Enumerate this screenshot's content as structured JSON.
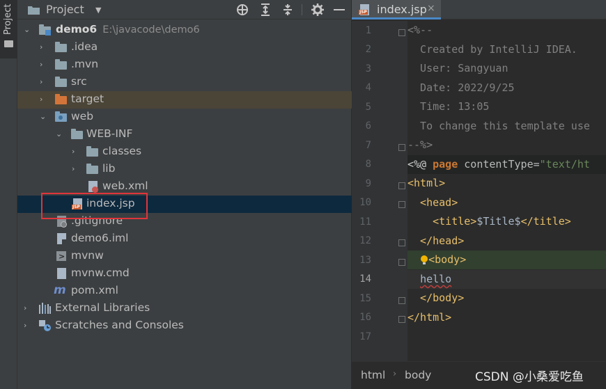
{
  "sidebar": {
    "vertical_tab": "Project"
  },
  "project_panel": {
    "title": "Project",
    "tree": [
      {
        "label": "demo6",
        "sub": "E:\\javacode\\demo6",
        "icon": "module-folder-icon",
        "expanded": true
      },
      {
        "label": ".idea",
        "icon": "folder-icon",
        "expanded": false
      },
      {
        "label": ".mvn",
        "icon": "folder-icon",
        "expanded": false
      },
      {
        "label": "src",
        "icon": "folder-icon",
        "expanded": false
      },
      {
        "label": "target",
        "icon": "excluded-folder-icon",
        "expanded": false
      },
      {
        "label": "web",
        "icon": "web-folder-icon",
        "expanded": true
      },
      {
        "label": "WEB-INF",
        "icon": "folder-icon",
        "expanded": true
      },
      {
        "label": "classes",
        "icon": "folder-icon",
        "expanded": false
      },
      {
        "label": "lib",
        "icon": "folder-icon",
        "expanded": false
      },
      {
        "label": "web.xml",
        "icon": "xml-file-icon"
      },
      {
        "label": "index.jsp",
        "icon": "jsp-file-icon"
      },
      {
        "label": ".gitignore",
        "icon": "gitignore-file-icon"
      },
      {
        "label": "demo6.iml",
        "icon": "iml-file-icon"
      },
      {
        "label": "mvnw",
        "icon": "script-file-icon"
      },
      {
        "label": "mvnw.cmd",
        "icon": "file-icon"
      },
      {
        "label": "pom.xml",
        "icon": "maven-icon"
      },
      {
        "label": "External Libraries",
        "icon": "libraries-icon",
        "expanded": false
      },
      {
        "label": "Scratches and Consoles",
        "icon": "scratches-icon",
        "expanded": false
      }
    ]
  },
  "editor": {
    "tab": {
      "label": "index.jsp",
      "close": "×"
    },
    "current_line": 14,
    "lines": [
      {
        "n": "1"
      },
      {
        "n": "2"
      },
      {
        "n": "3"
      },
      {
        "n": "4"
      },
      {
        "n": "5"
      },
      {
        "n": "6"
      },
      {
        "n": "7"
      },
      {
        "n": "8"
      },
      {
        "n": "9"
      },
      {
        "n": "10"
      },
      {
        "n": "11"
      },
      {
        "n": "12"
      },
      {
        "n": "13"
      },
      {
        "n": "14"
      },
      {
        "n": "15"
      },
      {
        "n": "16"
      },
      {
        "n": "17"
      }
    ],
    "code": {
      "l1": "<%--",
      "l2": "  Created by IntelliJ IDEA.",
      "l3": "  User: Sangyuan",
      "l4": "  Date: 2022/9/25",
      "l5": "  Time: 13:05",
      "l6": "  To change this template use",
      "l7": "--%>",
      "l8_open": "<%@ ",
      "l8_kw": "page",
      "l8_attr": " contentType=",
      "l8_str": "\"text/ht",
      "l9": "<html>",
      "l10": "  <head>",
      "l11_open": "    <title>",
      "l11_text": "$Title$",
      "l11_close": "</title>",
      "l12": "  </head>",
      "l13": "<body>",
      "l14": "hello",
      "l15": "  </body>",
      "l16": "</html>"
    },
    "breadcrumb": [
      "html",
      "body"
    ]
  },
  "watermark": "CSDN @小桑爱吃鱼"
}
